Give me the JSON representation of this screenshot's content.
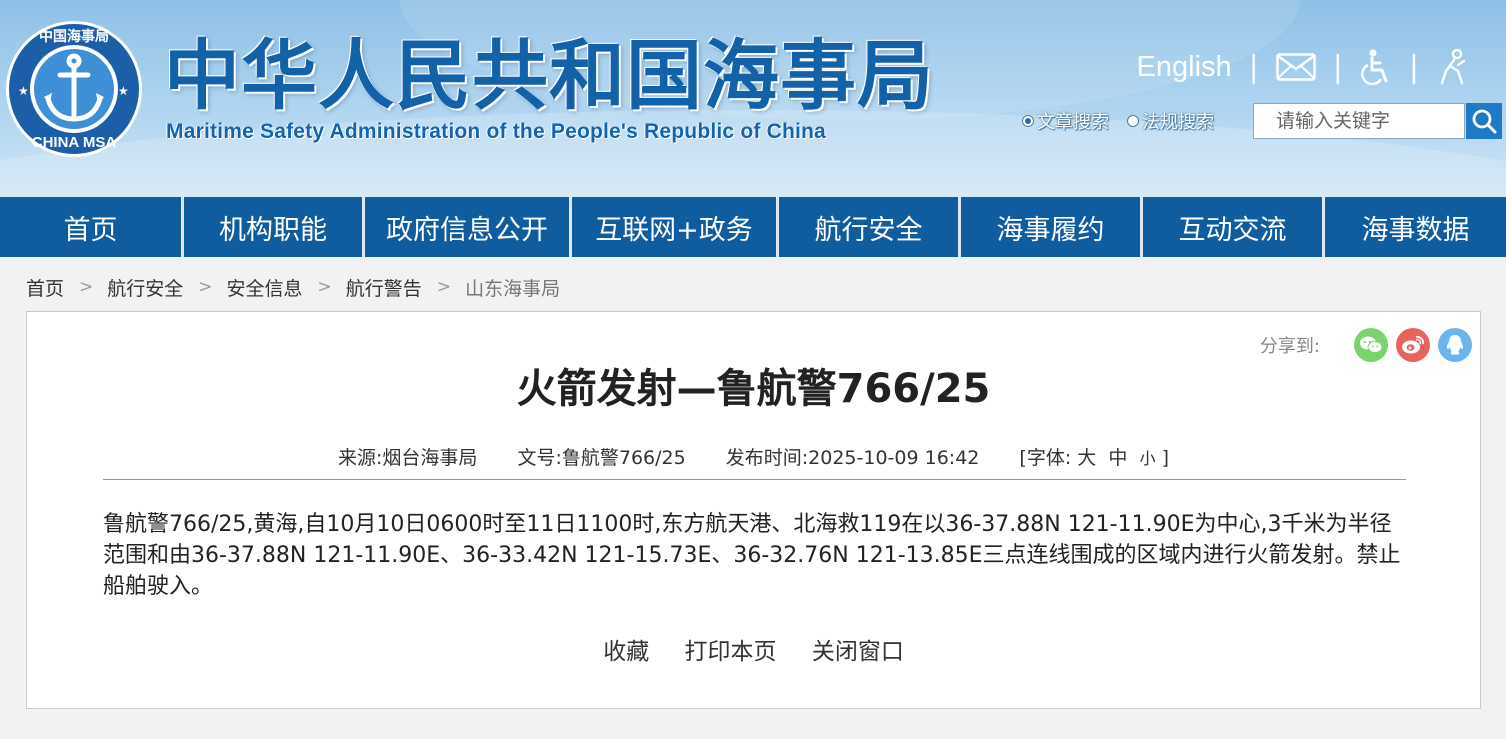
{
  "header": {
    "title": "中华人民共和国海事局",
    "subtitle": "Maritime Safety Administration of the People's Republic of China",
    "emblem_text": "中国海事局",
    "emblem_bottom": "CHINA MSA",
    "english_label": "English",
    "icons": [
      "mail-icon",
      "accessibility-icon",
      "elder-care-icon"
    ],
    "search": {
      "options": [
        {
          "label": "文章搜索",
          "selected": true
        },
        {
          "label": "法规搜索",
          "selected": false
        }
      ],
      "placeholder": "请输入关键字"
    }
  },
  "nav": {
    "items": [
      {
        "label": "首页"
      },
      {
        "label": "机构职能"
      },
      {
        "label": "政府信息公开"
      },
      {
        "label": "互联网+政务"
      },
      {
        "label": "航行安全"
      },
      {
        "label": "海事履约"
      },
      {
        "label": "互动交流"
      },
      {
        "label": "海事数据"
      }
    ]
  },
  "breadcrumb": {
    "sep": ">",
    "items": [
      "首页",
      "航行安全",
      "安全信息",
      "航行警告",
      "山东海事局"
    ]
  },
  "article": {
    "share_label": "分享到:",
    "title": "火箭发射—鲁航警766/25",
    "meta": {
      "source": "来源:烟台海事局",
      "doc_no": "文号:鲁航警766/25",
      "publish_time": "发布时间:2025-10-09 16:42",
      "font_prefix": "[字体:",
      "font_large": "大",
      "font_medium": "中",
      "font_small": "小",
      "font_suffix": "]"
    },
    "content": "鲁航警766/25,黄海,自10月10日0600时至11日1100时,东方航天港、北海救119在以36-37.88N 121-11.90E为中心,3千米为半径范围和由36-37.88N 121-11.90E、36-33.42N 121-15.73E、36-32.76N 121-13.85E三点连线围成的区域内进行火箭发射。禁止船舶驶入。",
    "actions": [
      "收藏",
      "打印本页",
      "关闭窗口"
    ]
  },
  "colors": {
    "brand_blue": "#1362a9",
    "nav_blue": "#0f5c9f",
    "search_button": "#1f78c8"
  }
}
